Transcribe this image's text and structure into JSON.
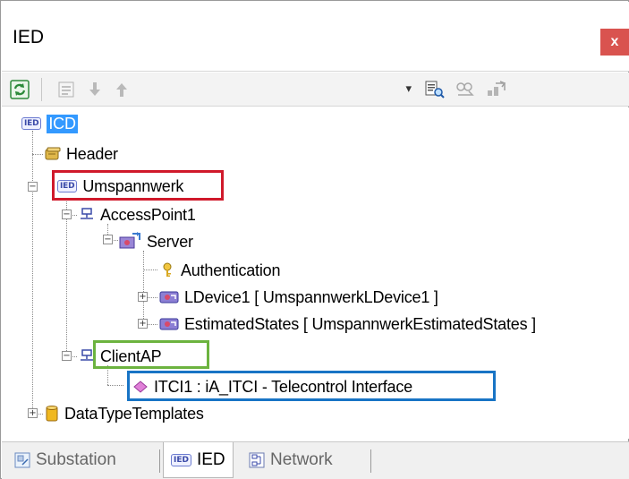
{
  "window": {
    "title": "IED",
    "close_label": "x"
  },
  "toolbar": {
    "icons": [
      "refresh-icon",
      "properties-icon",
      "move-down-icon",
      "move-up-icon",
      "combo-dropdown",
      "search-icon",
      "find-replace-icon",
      "export-icon"
    ],
    "combo_value": ""
  },
  "tree": {
    "root": "ICD",
    "header": "Header",
    "ied": "Umspannwerk",
    "access_point1": "AccessPoint1",
    "server": "Server",
    "authentication": "Authentication",
    "ldevice1": "LDevice1 [ UmspannwerkLDevice1 ]",
    "estimated_states": "EstimatedStates [ UmspannwerkEstimatedStates ]",
    "client_ap": "ClientAP",
    "itci": "ITCI1 : iA_ITCI - Telecontrol Interface",
    "data_type_templates": "DataTypeTemplates"
  },
  "badges": {
    "ied": "IED"
  },
  "tabs": [
    {
      "label": "Substation",
      "active": false
    },
    {
      "label": "IED",
      "active": true
    },
    {
      "label": "Network",
      "active": false
    }
  ],
  "colors": {
    "highlight_red": "#d0192b",
    "highlight_green": "#6cb33f",
    "highlight_blue": "#1874c5",
    "selection": "#3399ff",
    "close_button": "#d9534f"
  }
}
